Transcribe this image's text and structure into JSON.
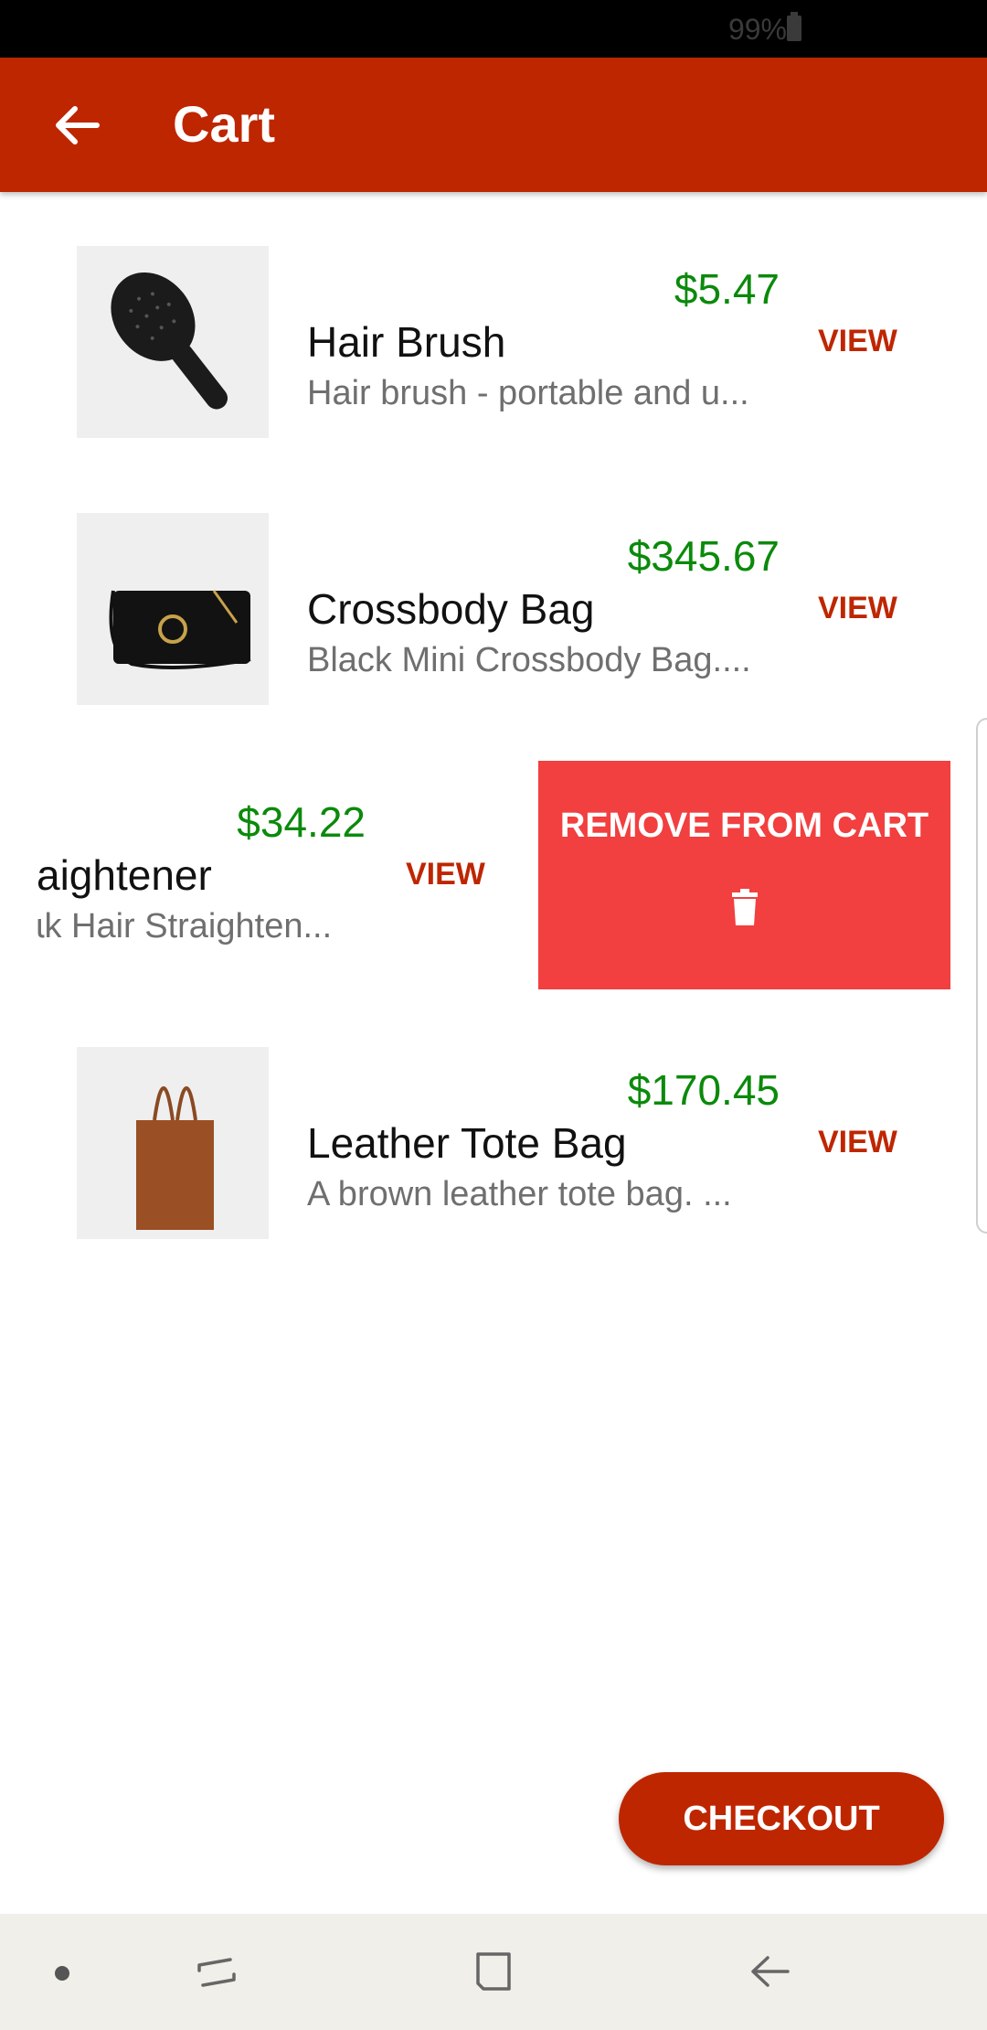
{
  "status_bar": {
    "battery": "99%"
  },
  "app_bar": {
    "title": "Cart"
  },
  "items": [
    {
      "price": "$5.47",
      "name": "Hair Brush",
      "desc": "Hair brush - portable and u...",
      "view": "VIEW"
    },
    {
      "price": "$345.67",
      "name": "Crossbody Bag",
      "desc": "Black Mini Crossbody Bag....",
      "view": "VIEW"
    },
    {
      "price": "$34.22",
      "name": "aightener",
      "desc": "ɩk Hair Straighten...",
      "view": "VIEW"
    },
    {
      "price": "$170.45",
      "name": "Leather Tote Bag",
      "desc": "A brown leather tote bag. ...",
      "view": "VIEW"
    }
  ],
  "remove_panel": {
    "label": "REMOVE FROM CART"
  },
  "checkout": {
    "label": "CHECKOUT"
  },
  "colors": {
    "accent": "#be2600",
    "price": "#0b8a0b",
    "remove": "#f23f3f"
  }
}
